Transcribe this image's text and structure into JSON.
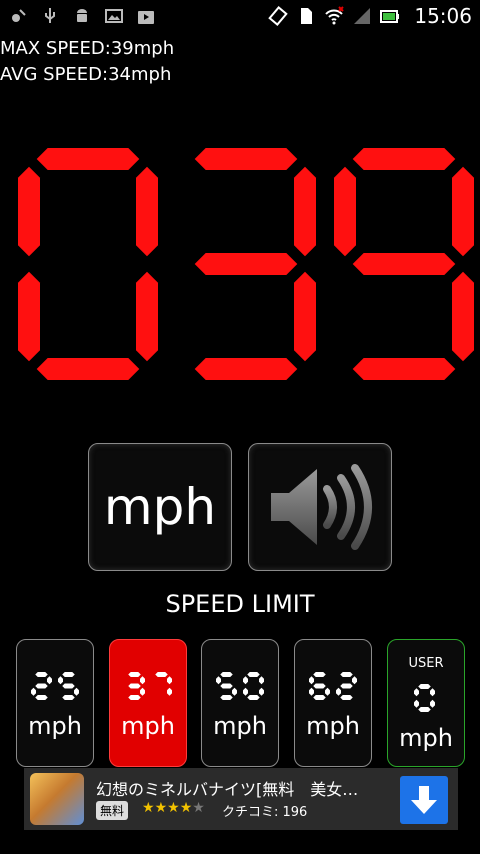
{
  "status_bar": {
    "time": "15:06",
    "left_icons": [
      "satellite-icon",
      "usb-icon",
      "android-icon",
      "image-icon",
      "play-store-icon"
    ],
    "right_icons": [
      "rotate-icon",
      "sim-icon",
      "wifi-icon",
      "signal-icon",
      "battery-icon"
    ]
  },
  "stats": {
    "max_speed": "MAX SPEED:39mph",
    "avg_speed": "AVG SPEED:34mph"
  },
  "speed_display": {
    "value": "039",
    "color": "#ff1010"
  },
  "controls": {
    "unit_button_label": "mph",
    "sound_button_icon": "speaker-icon"
  },
  "speed_limit": {
    "label": "SPEED LIMIT",
    "presets": [
      {
        "value": "25",
        "unit": "mph",
        "active": false
      },
      {
        "value": "37",
        "unit": "mph",
        "active": true
      },
      {
        "value": "50",
        "unit": "mph",
        "active": false
      },
      {
        "value": "62",
        "unit": "mph",
        "active": false
      }
    ],
    "user": {
      "label": "USER",
      "value": "0",
      "unit": "mph"
    }
  },
  "ad": {
    "title": "幻想のミネルバナイツ[無料　美女…",
    "free_badge": "無料",
    "rating_stars": 4,
    "review": "クチコミ: 196",
    "download_icon": "download-icon"
  },
  "colors": {
    "accent_red": "#e10000",
    "user_border": "#2aa52a",
    "download": "#1d73e8"
  }
}
